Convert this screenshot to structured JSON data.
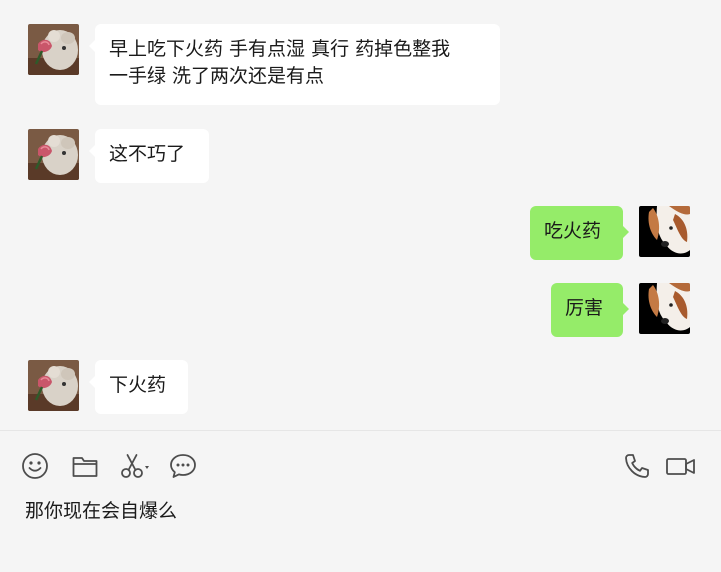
{
  "messages": [
    {
      "direction": "incoming",
      "sender": "cat-rose",
      "text": "早上吃下火药 手有点湿 真行 药掉色整我\n一手绿 洗了两次还是有点"
    },
    {
      "direction": "incoming",
      "sender": "cat-rose",
      "text": "这不巧了"
    },
    {
      "direction": "outgoing",
      "sender": "dog",
      "text": "吃火药"
    },
    {
      "direction": "outgoing",
      "sender": "dog",
      "text": "厉害"
    },
    {
      "direction": "incoming",
      "sender": "cat-rose",
      "text": "下火药"
    }
  ],
  "toolbar": {
    "left_icons": [
      "emoji-icon",
      "folder-icon",
      "scissors-icon",
      "chat-bubble-icon"
    ],
    "right_icons": [
      "phone-icon",
      "video-call-icon"
    ]
  },
  "composer": {
    "text": "那你现在会自爆么"
  },
  "colors": {
    "background": "#f5f5f5",
    "incoming_bubble": "#ffffff",
    "outgoing_bubble": "#95ec69",
    "icon": "#4d4d4d"
  }
}
